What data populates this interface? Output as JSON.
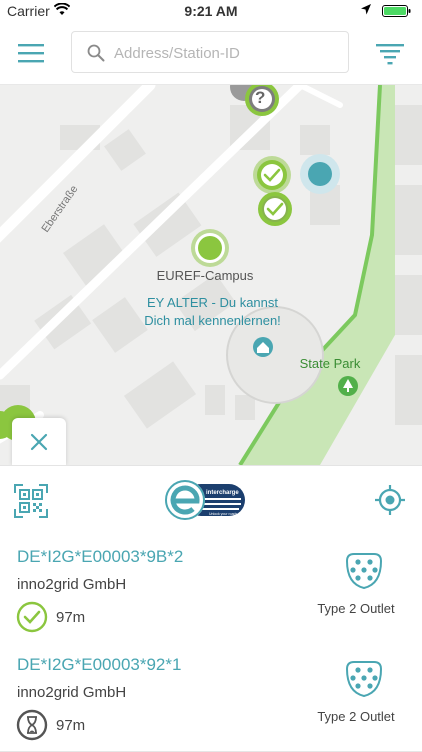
{
  "status_bar": {
    "carrier": "Carrier",
    "time": "9:21 AM"
  },
  "search": {
    "placeholder": "Address/Station-ID",
    "value": ""
  },
  "map": {
    "street_label": "Eberstraße",
    "campus_label": "EUREF-Campus",
    "poi_label_line1": "EY ALTER - Du kannst",
    "poi_label_line2": "Dich mal kennenlernen!",
    "park_label": "State Park",
    "marker_available_color": "#8bc63f",
    "marker_unknown_symbol": "?"
  },
  "toolbar": {
    "logo_text": "intercharge",
    "logo_subtext": "Unlock your roads."
  },
  "stations": [
    {
      "id": "DE*I2G*E00003*9B*2",
      "operator": "inno2grid GmbH",
      "distance": "97m",
      "plug_type": "Type 2 Outlet",
      "status": "available"
    },
    {
      "id": "DE*I2G*E00003*92*1",
      "operator": "inno2grid GmbH",
      "distance": "97m",
      "plug_type": "Type 2 Outlet",
      "status": "pending"
    }
  ],
  "colors": {
    "accent": "#4aa6b2",
    "available_green": "#8bc63f",
    "park_green": "#c9e6b6",
    "road_green": "#7cc95e"
  }
}
